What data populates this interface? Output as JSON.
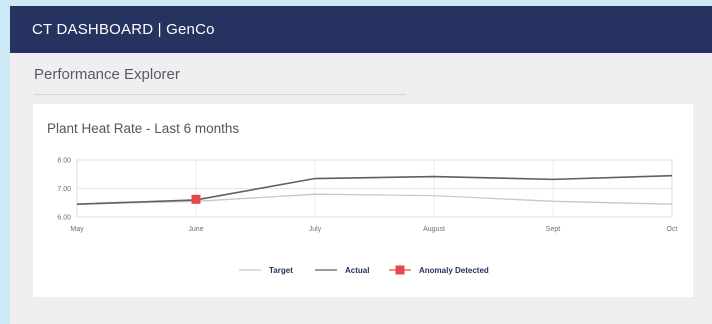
{
  "header": {
    "title": "CT DASHBOARD | GenCo"
  },
  "page": {
    "section_title": "Performance Explorer"
  },
  "chart_card": {
    "title": "Plant Heat Rate - Last 6 months"
  },
  "colors": {
    "header_bg": "#263260",
    "target_line": "#c8c8c8",
    "actual_line": "#5f5f64",
    "anomaly": "#e8474a"
  },
  "chart_data": {
    "type": "line",
    "categories": [
      "May",
      "June",
      "July",
      "August",
      "Sept",
      "Oct"
    ],
    "ylim": [
      6.0,
      8.0
    ],
    "yticks": [
      "6.00",
      "7.00",
      "8.00"
    ],
    "grid": true,
    "legend_position": "bottom",
    "series": [
      {
        "name": "Target",
        "values": [
          6.45,
          6.55,
          6.8,
          6.75,
          6.55,
          6.45
        ]
      },
      {
        "name": "Actual",
        "values": [
          6.45,
          6.6,
          7.35,
          7.42,
          7.32,
          7.45
        ]
      }
    ],
    "anomalies": [
      {
        "name": "Anomaly Detected",
        "category": "June",
        "value": 6.62
      }
    ]
  }
}
